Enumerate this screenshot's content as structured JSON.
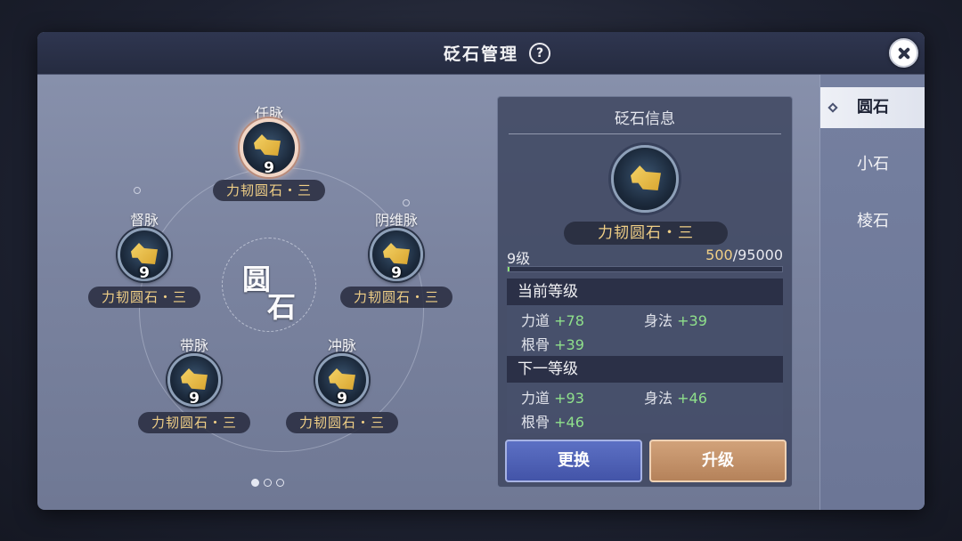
{
  "dialog": {
    "title": "砭石管理",
    "help_label": "?"
  },
  "circle": {
    "center_char_1": "圆",
    "center_char_2": "石"
  },
  "slots": [
    {
      "meridian": "任脉",
      "level": "9",
      "stone_name": "力韧圆石・三",
      "selected": true
    },
    {
      "meridian": "督脉",
      "level": "9",
      "stone_name": "力韧圆石・三",
      "selected": false
    },
    {
      "meridian": "阴维脉",
      "level": "9",
      "stone_name": "力韧圆石・三",
      "selected": false
    },
    {
      "meridian": "带脉",
      "level": "9",
      "stone_name": "力韧圆石・三",
      "selected": false
    },
    {
      "meridian": "冲脉",
      "level": "9",
      "stone_name": "力韧圆石・三",
      "selected": false
    }
  ],
  "info": {
    "title": "砭石信息",
    "stone_name": "力韧圆石・三",
    "level_label": "9级",
    "exp_current": "500",
    "exp_max": "/95000",
    "exp_fraction": 0.005,
    "current_level_header": "当前等级",
    "current_stats": [
      {
        "label": "力道",
        "value": "+78"
      },
      {
        "label": "身法",
        "value": "+39"
      },
      {
        "label": "根骨",
        "value": "+39"
      }
    ],
    "next_level_header": "下一等级",
    "next_stats": [
      {
        "label": "力道",
        "value": "+93"
      },
      {
        "label": "身法",
        "value": "+46"
      },
      {
        "label": "根骨",
        "value": "+46"
      }
    ],
    "replace_button": "更换",
    "upgrade_button": "升级"
  },
  "tabs": [
    {
      "label": "圆石",
      "active": true
    },
    {
      "label": "小石",
      "active": false
    },
    {
      "label": "棱石",
      "active": false
    }
  ],
  "colors": {
    "stone_name_gold": "#f0cf86",
    "stat_green": "#8fe08b",
    "replace_blue": "#4f62b6",
    "upgrade_tan": "#c3926a"
  }
}
